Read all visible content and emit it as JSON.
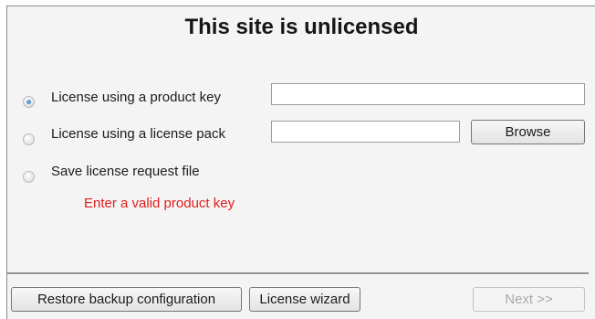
{
  "dialog": {
    "title": "This site is unlicensed",
    "options": [
      {
        "label": "License using a product key",
        "selected": true
      },
      {
        "label": "License using a license pack",
        "selected": false
      },
      {
        "label": "Save license request file",
        "selected": false
      }
    ],
    "product_key_value": "",
    "license_pack_value": "",
    "browse_label": "Browse",
    "error_message": "Enter a valid product key",
    "error_color": "#e31c1c"
  },
  "footer": {
    "restore_label": "Restore backup configuration",
    "wizard_label": "License wizard",
    "next_label": "Next >>",
    "next_enabled": false
  }
}
